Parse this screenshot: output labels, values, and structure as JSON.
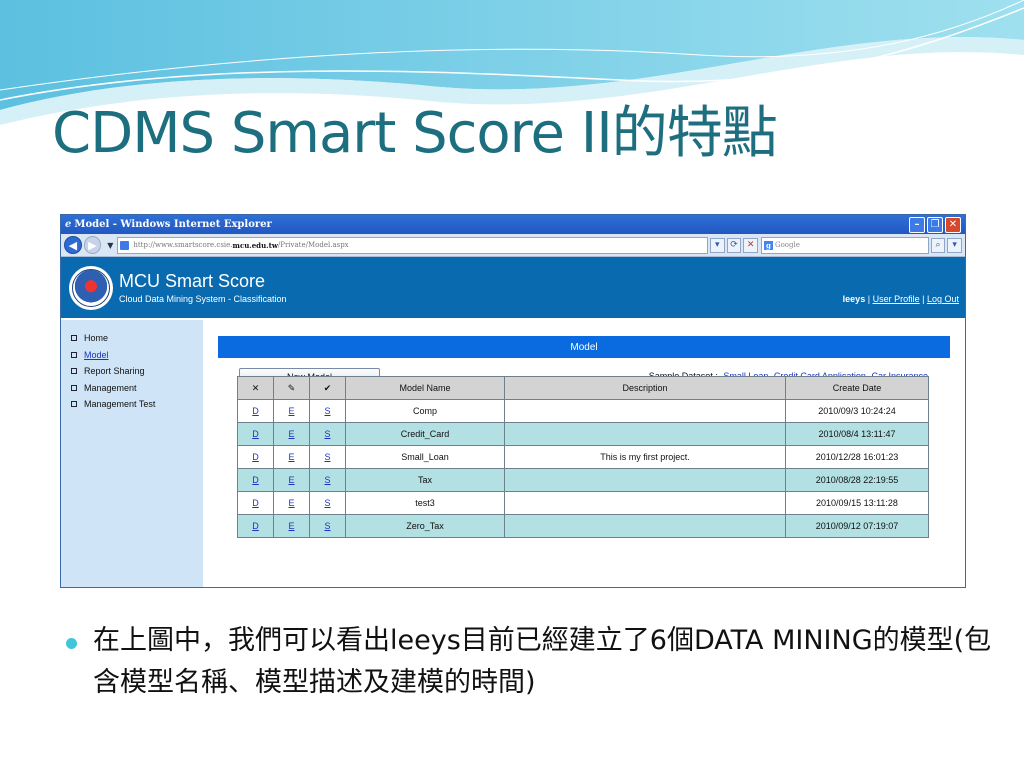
{
  "slide": {
    "title": "CDMS Smart Score II的特點",
    "bullet": "在上圖中，我們可以看出leeys目前已經建立了6個DATA MINING的模型(包含模型名稱、模型描述及建模的時間)"
  },
  "browser": {
    "title": "Model - Windows Internet Explorer",
    "address_prefix": "http://www.smartscore.csie.",
    "address_bold": "mcu.edu.tw",
    "address_suffix": "/Private/Model.aspx",
    "search_placeholder": "Google",
    "icons": [
      "back-arrow-icon",
      "forward-arrow-icon",
      "refresh-icon",
      "stop-icon",
      "search-icon",
      "minimize-icon",
      "restore-icon",
      "close-icon"
    ]
  },
  "app": {
    "name": "MCU Smart Score",
    "subtitle": "Cloud Data Mining System - Classification",
    "user": "leeys",
    "sep": "|",
    "user_profile": "User Profile",
    "logout": "Log Out"
  },
  "nav": [
    {
      "label": "Home"
    },
    {
      "label": "Model"
    },
    {
      "label": "Report Sharing"
    },
    {
      "label": "Management"
    },
    {
      "label": "Management Test"
    }
  ],
  "content": {
    "header": "Model",
    "new_model": "New Model",
    "sample_label": "Sample Dataset :",
    "samples": [
      "Small Loan",
      "Credit Card Application",
      "Car Insurance"
    ]
  },
  "table": {
    "icon_headers": [
      "✕",
      "✎",
      "✔"
    ],
    "headers": [
      "Model Name",
      "Description",
      "Create Date"
    ],
    "rows": [
      {
        "d": "D",
        "e": "E",
        "s": "S",
        "name": "Comp",
        "desc": "",
        "date": "2010/09/3 10:24:24"
      },
      {
        "d": "D",
        "e": "E",
        "s": "S",
        "name": "Credit_Card",
        "desc": "",
        "date": "2010/08/4 13:11:47"
      },
      {
        "d": "D",
        "e": "E",
        "s": "S",
        "name": "Small_Loan",
        "desc": "This is my first project.",
        "date": "2010/12/28 16:01:23"
      },
      {
        "d": "D",
        "e": "E",
        "s": "S",
        "name": "Tax",
        "desc": "",
        "date": "2010/08/28 22:19:55"
      },
      {
        "d": "D",
        "e": "E",
        "s": "S",
        "name": "test3",
        "desc": "",
        "date": "2010/09/15 13:11:28"
      },
      {
        "d": "D",
        "e": "E",
        "s": "S",
        "name": "Zero_Tax",
        "desc": "",
        "date": "2010/09/12 07:19:07"
      }
    ]
  },
  "colors": {
    "title": "#1d6f80",
    "app_header": "#0a6ab0",
    "content_bar": "#0a6ae0",
    "row_alt": "#b3e0e2",
    "bullet": "#3fc6dd"
  }
}
